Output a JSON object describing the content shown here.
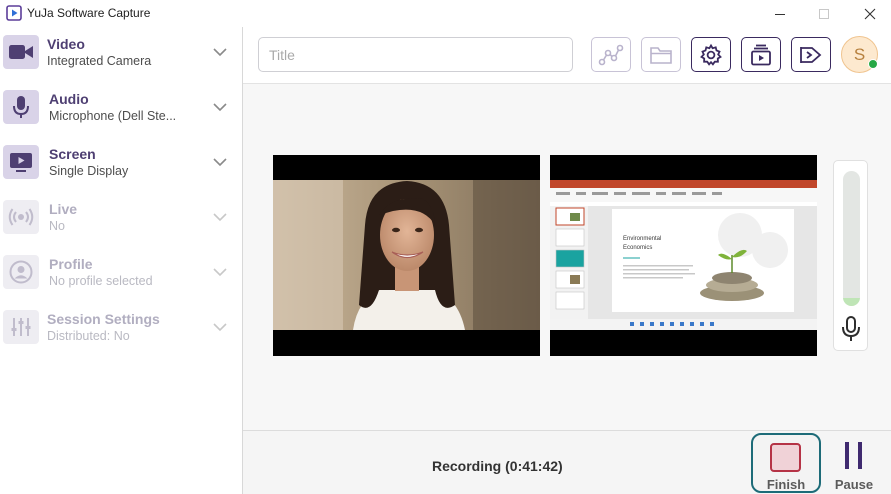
{
  "window": {
    "title": "YuJa Software Capture",
    "controls": [
      "minimize",
      "maximize",
      "close"
    ]
  },
  "sidebar": {
    "items": [
      {
        "title": "Video",
        "subtitle": "Integrated Camera",
        "icon": "video-camera-icon",
        "enabled": true
      },
      {
        "title": "Audio",
        "subtitle": "Microphone (Dell Ste...",
        "icon": "microphone-icon",
        "enabled": true
      },
      {
        "title": "Screen",
        "subtitle": "Single Display",
        "icon": "screen-icon",
        "enabled": true
      },
      {
        "title": "Live",
        "subtitle": "No",
        "icon": "live-broadcast-icon",
        "enabled": false
      },
      {
        "title": "Profile",
        "subtitle": "No profile selected",
        "icon": "profile-icon",
        "enabled": false
      },
      {
        "title": "Session Settings",
        "subtitle": "Distributed: No",
        "icon": "sliders-icon",
        "enabled": false
      }
    ]
  },
  "toolbar": {
    "title_placeholder": "Title",
    "title_value": "",
    "buttons": [
      {
        "icon": "workflow-icon",
        "enabled": false
      },
      {
        "icon": "folder-icon",
        "enabled": false
      },
      {
        "icon": "gear-icon",
        "enabled": true
      },
      {
        "icon": "media-library-icon",
        "enabled": true
      },
      {
        "icon": "announcement-icon",
        "enabled": true
      }
    ],
    "avatar_initial": "S",
    "presence_status": "online"
  },
  "previews": {
    "camera": "camera-preview",
    "screen": "screen-preview",
    "slide_title_line1": "Environmental",
    "slide_title_line2": "Economics"
  },
  "audio_meter": {
    "level": 0.06
  },
  "bottom": {
    "status": "Recording (0:41:42)",
    "finish_label": "Finish",
    "pause_label": "Pause"
  },
  "colors": {
    "accent": "#3a2a5f",
    "finish_border": "#1d6b78",
    "finish_square": "#b53346",
    "meter": "#bfe5b6",
    "presence": "#27a845"
  }
}
